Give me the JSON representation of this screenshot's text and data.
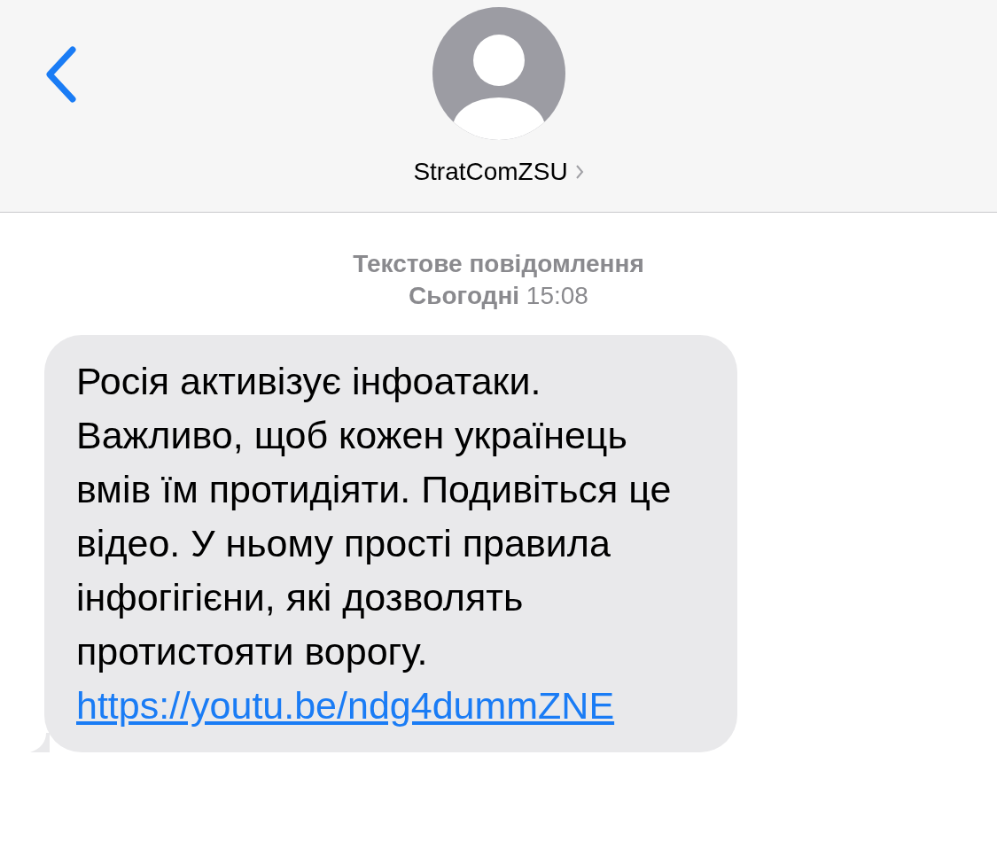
{
  "header": {
    "contact_name": "StratComZSU"
  },
  "meta": {
    "label": "Текстове повідомлення",
    "date": "**Сьогодні** 15:08"
  },
  "messages": [
    {
      "kind": "incoming",
      "text": "Росія активізує інфоатаки. Важливо, щоб кожен українець вмів їм протидіяти. Подивіться це відео. У ньому прості правила інфогігієни, які дозволять протистояти ворогу.",
      "link": "https://youtu.be/ndg4dummZNE"
    }
  ]
}
